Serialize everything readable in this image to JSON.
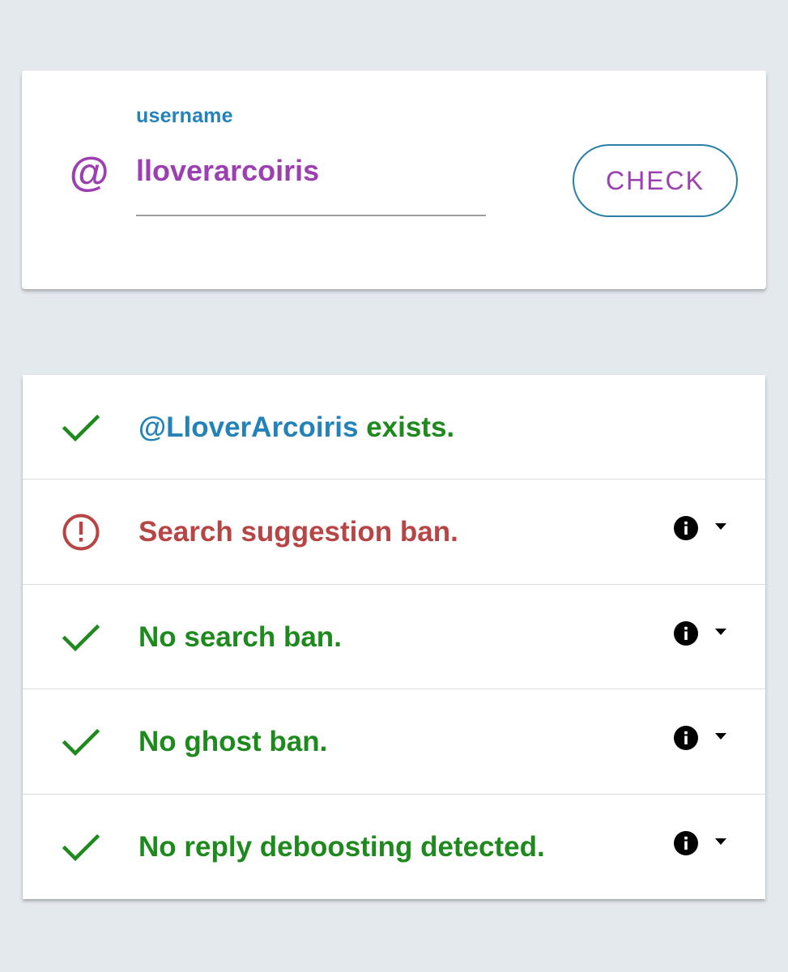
{
  "search": {
    "label": "username",
    "at_symbol": "@",
    "value": "lloverarcoiris",
    "check_label": "CHECK"
  },
  "results": [
    {
      "status": "ok",
      "handle": "@LloverArcoiris",
      "text": " exists.",
      "has_info": false
    },
    {
      "status": "error",
      "text": "Search suggestion ban.",
      "has_info": true
    },
    {
      "status": "ok",
      "text": "No search ban.",
      "has_info": true
    },
    {
      "status": "ok",
      "text": "No ghost ban.",
      "has_info": true
    },
    {
      "status": "ok",
      "text": "No reply deboosting detected.",
      "has_info": true
    }
  ],
  "icons": {
    "ok": "checkmark-icon",
    "error": "alert-circle-icon",
    "info": "info-icon",
    "expand": "caret-down-icon"
  },
  "colors": {
    "background": "#e4e9ee",
    "accent_purple": "#9b3fb1",
    "accent_blue": "#2383b8",
    "ok_green": "#1e8a1e",
    "error_red": "#b74545"
  }
}
